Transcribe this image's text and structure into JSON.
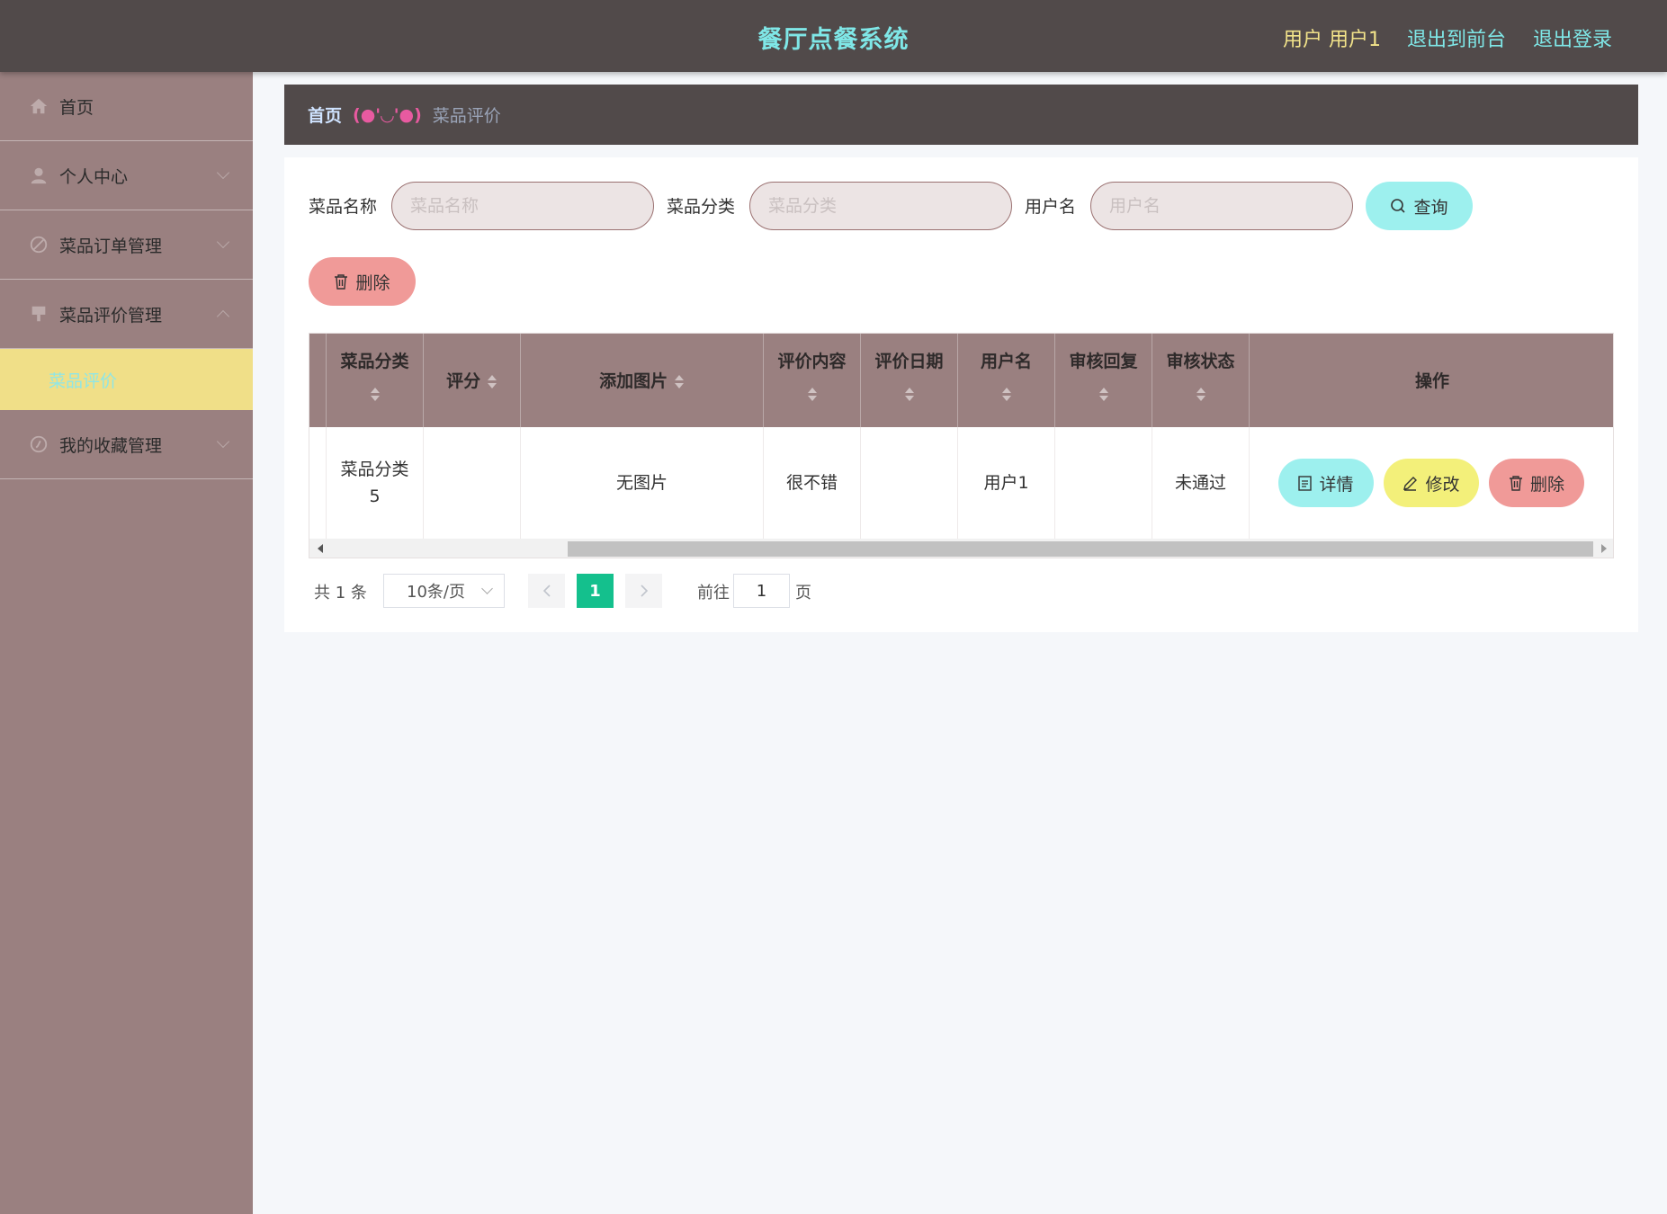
{
  "header": {
    "title": "餐厅点餐系统",
    "user_label": "用户 用户1",
    "front_link": "退出到前台",
    "logout_link": "退出登录"
  },
  "sidebar": {
    "items": [
      {
        "label": "首页",
        "icon": "home-icon"
      },
      {
        "label": "个人中心",
        "icon": "user-icon"
      },
      {
        "label": "菜品订单管理",
        "icon": "order-icon"
      },
      {
        "label": "菜品评价管理",
        "icon": "review-icon"
      },
      {
        "label": "我的收藏管理",
        "icon": "favorite-icon"
      }
    ],
    "submenu_active": "菜品评价"
  },
  "breadcrumb": {
    "home": "首页",
    "separator": "(●'◡'●)",
    "current": "菜品评价"
  },
  "search": {
    "name_label": "菜品名称",
    "name_placeholder": "菜品名称",
    "category_label": "菜品分类",
    "category_placeholder": "菜品分类",
    "username_label": "用户名",
    "username_placeholder": "用户名",
    "search_button": "查询"
  },
  "toolbar": {
    "delete_button": "删除"
  },
  "table": {
    "columns": [
      "菜品分类",
      "评分",
      "添加图片",
      "评价内容",
      "评价日期",
      "用户名",
      "审核回复",
      "审核状态",
      "操作"
    ],
    "rows": [
      {
        "category": "菜品分类5",
        "rating": "",
        "image": "无图片",
        "content": "很不错",
        "date": "",
        "username": "用户1",
        "reply": "",
        "status": "未通过",
        "actions": {
          "detail": "详情",
          "edit": "修改",
          "delete": "删除"
        }
      }
    ]
  },
  "pagination": {
    "total": "共 1 条",
    "page_size": "10条/页",
    "current_page": "1",
    "goto_label": "前往",
    "goto_value": "1",
    "page_suffix": "页"
  },
  "colors": {
    "header_bg": "#514a4a",
    "sidebar_bg": "#9a8080",
    "accent_cyan": "#9df0ee",
    "accent_yellow": "#f3f07a",
    "accent_red": "#f09a98",
    "active_page": "#14c08d"
  }
}
